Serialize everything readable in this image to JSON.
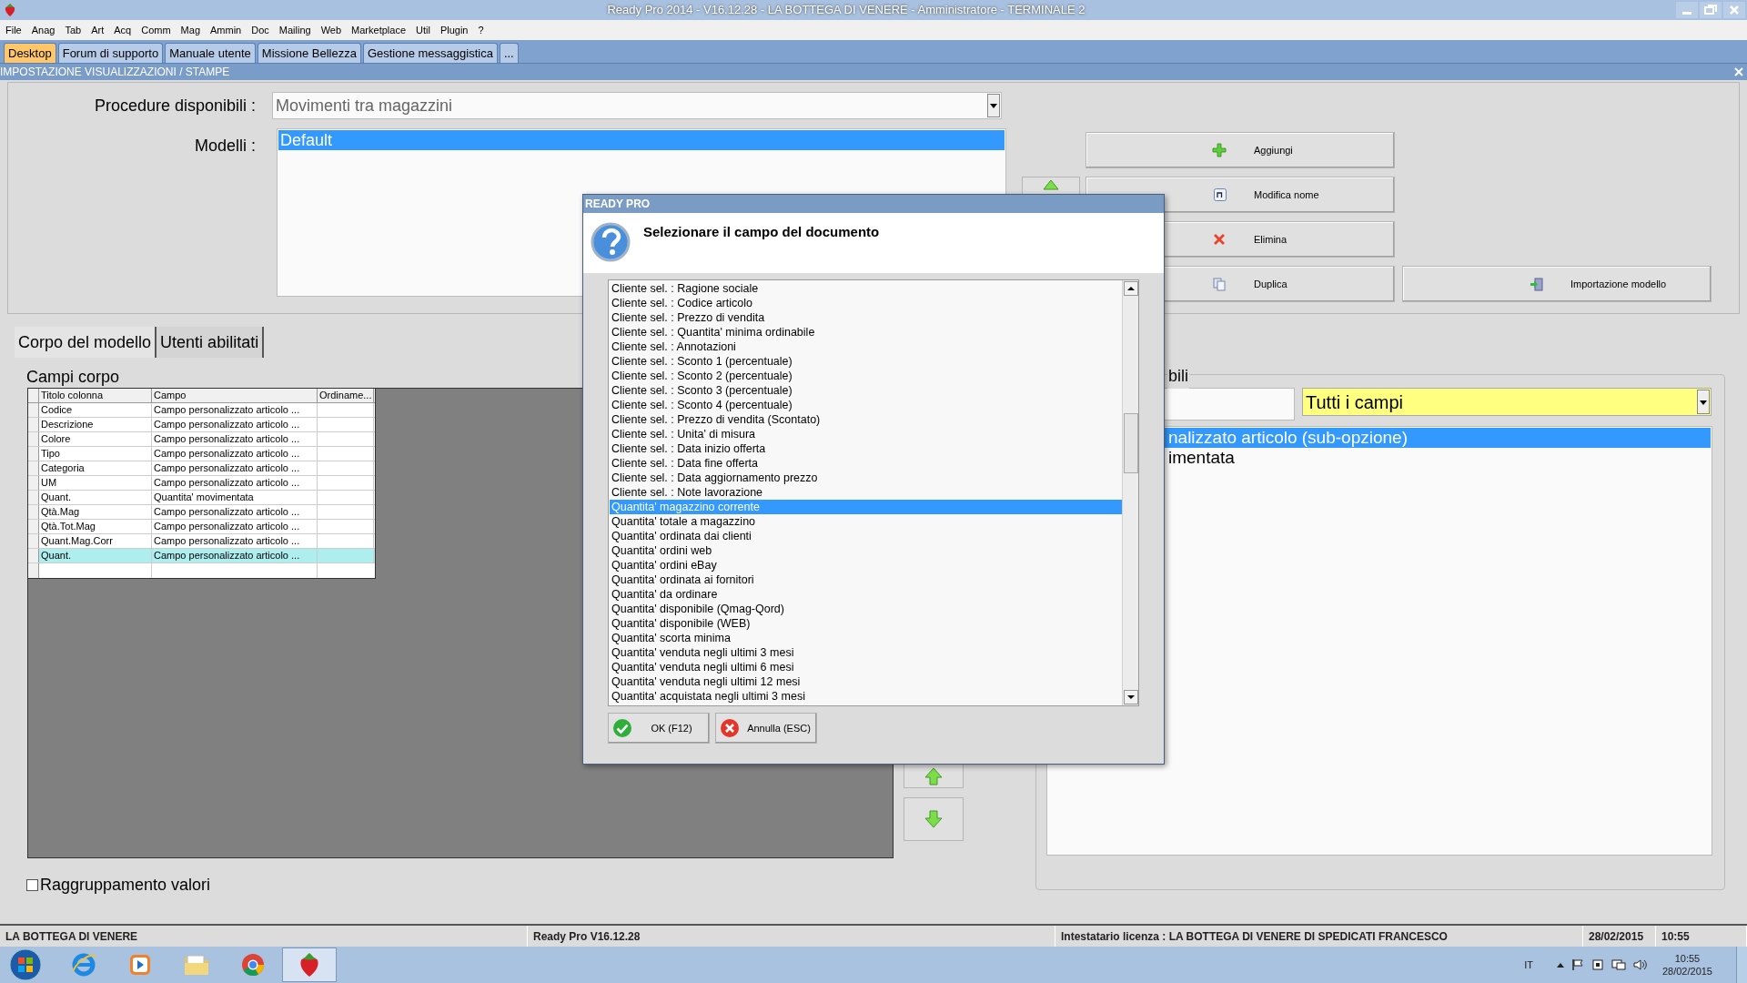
{
  "window": {
    "title": "Ready Pro 2014 - V16.12.28 - LA BOTTEGA DI VENERE - Amministratore - TERMINALE 2"
  },
  "menu": [
    "File",
    "Anag",
    "Tab",
    "Art",
    "Acq",
    "Comm",
    "Mag",
    "Ammin",
    "Doc",
    "Mailing",
    "Web",
    "Marketplace",
    "Util",
    "Plugin",
    "?"
  ],
  "tabs": [
    {
      "label": "Desktop",
      "selected": true
    },
    {
      "label": "Forum di supporto",
      "selected": false
    },
    {
      "label": "Manuale utente",
      "selected": false
    },
    {
      "label": "Missione Bellezza",
      "selected": false
    },
    {
      "label": "Gestione messaggistica",
      "selected": false
    },
    {
      "label": "...",
      "selected": false
    }
  ],
  "section_title": "IMPOSTAZIONE VISUALIZZAZIONI / STAMPE",
  "procedure": {
    "label": "Procedure disponibili :",
    "value": "Movimenti tra magazzini"
  },
  "models": {
    "label": "Modelli :",
    "items": [
      {
        "label": "Default",
        "selected": true
      }
    ]
  },
  "actions": [
    {
      "label": "Aggiungi",
      "kind": "add"
    },
    {
      "label": "Modifica nome",
      "kind": "rename"
    },
    {
      "label": "Elimina",
      "kind": "delete"
    },
    {
      "label": "Duplica",
      "kind": "copy"
    },
    {
      "label": "Importazione modello",
      "kind": "import"
    }
  ],
  "body_tabs": [
    {
      "label": "Corpo del modello",
      "selected": true
    },
    {
      "label": "Utenti abilitati",
      "selected": false
    }
  ],
  "body_fields": {
    "title": "Campi corpo",
    "columns": [
      "Titolo colonna",
      "Campo",
      "Ordiname..."
    ],
    "rows": [
      {
        "cells": [
          "Codice",
          "Campo personalizzato articolo ...",
          ""
        ],
        "selected": false
      },
      {
        "cells": [
          "Descrizione",
          "Campo personalizzato articolo ...",
          ""
        ],
        "selected": false
      },
      {
        "cells": [
          "Colore",
          "Campo personalizzato articolo ...",
          ""
        ],
        "selected": false
      },
      {
        "cells": [
          "Tipo",
          "Campo personalizzato articolo ...",
          ""
        ],
        "selected": false
      },
      {
        "cells": [
          "Categoria",
          "Campo personalizzato articolo ...",
          ""
        ],
        "selected": false
      },
      {
        "cells": [
          "UM",
          "Campo personalizzato articolo ...",
          ""
        ],
        "selected": false
      },
      {
        "cells": [
          "Quant.",
          "Quantita' movimentata",
          ""
        ],
        "selected": false
      },
      {
        "cells": [
          "Qtà.Mag",
          "Campo personalizzato articolo ...",
          ""
        ],
        "selected": false
      },
      {
        "cells": [
          "Qtà.Tot.Mag",
          "Campo personalizzato articolo ...",
          ""
        ],
        "selected": false
      },
      {
        "cells": [
          "Quant.Mag.Corr",
          "Campo personalizzato articolo ...",
          ""
        ],
        "selected": false
      },
      {
        "cells": [
          "Quant.",
          "Campo personalizzato articolo ...",
          ""
        ],
        "selected": true
      }
    ]
  },
  "grouping": {
    "label": "Raggruppamento valori",
    "checked": false
  },
  "available": {
    "legend": "bili",
    "filter": "Tutti i campi",
    "items": [
      {
        "label": "nalizzato articolo (sub-opzione)",
        "selected": true
      },
      {
        "label": "imentata",
        "selected": false
      }
    ]
  },
  "dialog": {
    "title": "READY PRO",
    "message": "Selezionare il campo del documento",
    "items": [
      {
        "label": "Cliente sel. : Ragione sociale",
        "selected": false
      },
      {
        "label": "Cliente sel. : Codice articolo",
        "selected": false
      },
      {
        "label": "Cliente sel. : Prezzo di vendita",
        "selected": false
      },
      {
        "label": "Cliente sel. : Quantita' minima ordinabile",
        "selected": false
      },
      {
        "label": "Cliente sel. : Annotazioni",
        "selected": false
      },
      {
        "label": "Cliente sel. : Sconto 1 (percentuale)",
        "selected": false
      },
      {
        "label": "Cliente sel. : Sconto 2 (percentuale)",
        "selected": false
      },
      {
        "label": "Cliente sel. : Sconto 3 (percentuale)",
        "selected": false
      },
      {
        "label": "Cliente sel. : Sconto 4 (percentuale)",
        "selected": false
      },
      {
        "label": "Cliente sel. : Prezzo di vendita (Scontato)",
        "selected": false
      },
      {
        "label": "Cliente sel. : Unita' di misura",
        "selected": false
      },
      {
        "label": "Cliente sel. : Data inizio offerta",
        "selected": false
      },
      {
        "label": "Cliente sel. : Data fine offerta",
        "selected": false
      },
      {
        "label": "Cliente sel. : Data aggiornamento prezzo",
        "selected": false
      },
      {
        "label": "Cliente sel. : Note lavorazione",
        "selected": false
      },
      {
        "label": "Quantita' magazzino corrente",
        "selected": true
      },
      {
        "label": "Quantita' totale a magazzino",
        "selected": false
      },
      {
        "label": "Quantita' ordinata dai clienti",
        "selected": false
      },
      {
        "label": "Quantita' ordini web",
        "selected": false
      },
      {
        "label": "Quantita' ordini eBay",
        "selected": false
      },
      {
        "label": "Quantita' ordinata ai fornitori",
        "selected": false
      },
      {
        "label": "Quantita' da ordinare",
        "selected": false
      },
      {
        "label": "Quantita' disponibile (Qmag-Qord)",
        "selected": false
      },
      {
        "label": "Quantita' disponibile (WEB)",
        "selected": false
      },
      {
        "label": "Quantita' scorta minima",
        "selected": false
      },
      {
        "label": "Quantita' venduta negli ultimi 3 mesi",
        "selected": false
      },
      {
        "label": "Quantita' venduta negli ultimi 6 mesi",
        "selected": false
      },
      {
        "label": "Quantita' venduta negli ultimi 12 mesi",
        "selected": false
      },
      {
        "label": "Quantita' acquistata negli ultimi 3 mesi",
        "selected": false
      }
    ],
    "buttons": [
      {
        "label": "OK (F12)",
        "kind": "ok"
      },
      {
        "label": "Annulla (ESC)",
        "kind": "cancel"
      }
    ]
  },
  "status_bar": [
    "LA BOTTEGA DI VENERE",
    "Ready Pro V16.12.28",
    "Intestatario licenza : LA BOTTEGA DI VENERE DI SPEDICATI FRANCESCO",
    "28/02/2015",
    "10:55"
  ],
  "taskbar": {
    "apps": [
      {
        "kind": "browser-e",
        "selected": false
      },
      {
        "kind": "media",
        "selected": false
      },
      {
        "kind": "folder",
        "selected": false
      },
      {
        "kind": "chrome",
        "selected": false
      },
      {
        "kind": "strawberry",
        "selected": true
      }
    ],
    "language": "IT",
    "time": "10:55",
    "date": "28/02/2015"
  }
}
